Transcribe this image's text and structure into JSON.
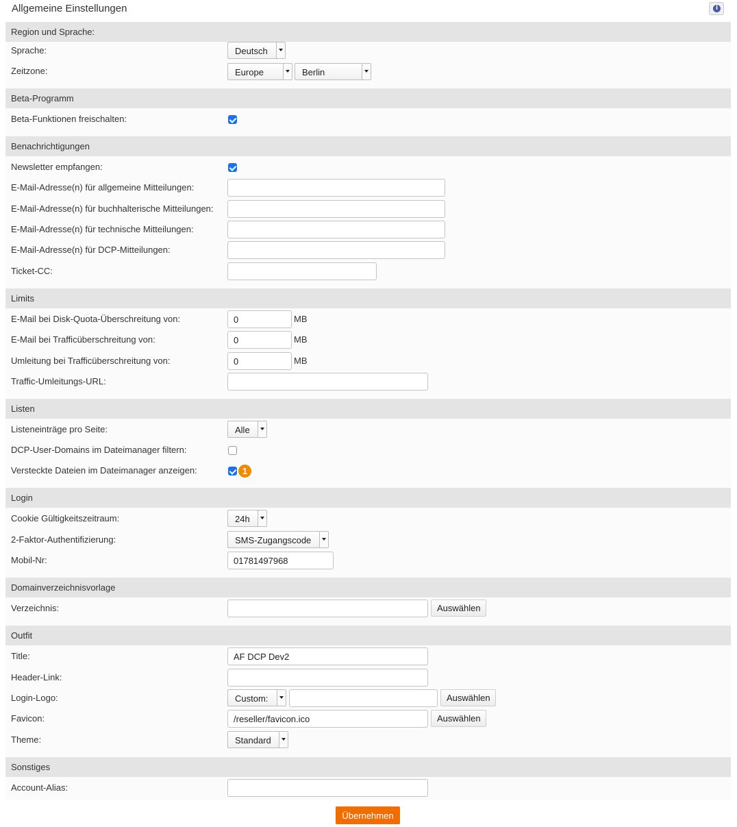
{
  "page": {
    "title": "Allgemeine Einstellungen",
    "info_icon": "info-icon",
    "submit_label": "Übernehmen"
  },
  "colors": {
    "section_bg": "#e4e4e4",
    "panel_bg": "#fbfbfb",
    "checkbox_accent": "#1a73e8",
    "submit_bg": "#f26d00",
    "badge_bg": "#f08a00"
  },
  "region": {
    "header": "Region und Sprache:",
    "language_label": "Sprache:",
    "language_value": "Deutsch",
    "timezone_label": "Zeitzone:",
    "timezone_region": "Europe",
    "timezone_city": "Berlin"
  },
  "beta": {
    "header": "Beta-Programm",
    "unlock_label": "Beta-Funktionen freischalten:",
    "unlock_checked": true
  },
  "notifications": {
    "header": "Benachrichtigungen",
    "newsletter_label": "Newsletter empfangen:",
    "newsletter_checked": true,
    "general_label": "E-Mail-Adresse(n) für allgemeine Mitteilungen:",
    "general_value": "",
    "accounting_label": "E-Mail-Adresse(n) für buchhalterische Mitteilungen:",
    "accounting_value": "",
    "technical_label": "E-Mail-Adresse(n) für technische Mitteilungen:",
    "technical_value": "",
    "dcp_label": "E-Mail-Adresse(n) für DCP-Mitteilungen:",
    "dcp_value": "",
    "ticket_cc_label": "Ticket-CC:",
    "ticket_cc_value": ""
  },
  "limits": {
    "header": "Limits",
    "disk_quota_label": "E-Mail bei Disk-Quota-Überschreitung von:",
    "disk_quota_value": "0",
    "traffic_mail_label": "E-Mail bei Trafficüberschreitung von:",
    "traffic_mail_value": "0",
    "redirect_label": "Umleitung bei Trafficüberschreitung von:",
    "redirect_value": "0",
    "unit": "MB",
    "redirect_url_label": "Traffic-Umleitungs-URL:",
    "redirect_url_value": ""
  },
  "lists": {
    "header": "Listen",
    "per_page_label": "Listeneinträge pro Seite:",
    "per_page_value": "Alle",
    "filter_label": "DCP-User-Domains im Dateimanager filtern:",
    "filter_checked": false,
    "hidden_files_label": "Versteckte Dateien im Dateimanager anzeigen:",
    "hidden_files_checked": true,
    "badge": "1"
  },
  "login": {
    "header": "Login",
    "cookie_label": "Cookie Gültigkeitszeitraum:",
    "cookie_value": "24h",
    "twofa_label": "2-Faktor-Authentifizierung:",
    "twofa_value": "SMS-Zugangscode",
    "mobile_label": "Mobil-Nr:",
    "mobile_value": "01781497968"
  },
  "domain_template": {
    "header": "Domainverzeichnisvorlage",
    "dir_label": "Verzeichnis:",
    "dir_value": "",
    "choose_label": "Auswählen"
  },
  "outfit": {
    "header": "Outfit",
    "title_label": "Title:",
    "title_value": "AF DCP Dev2",
    "header_link_label": "Header-Link:",
    "header_link_value": "",
    "login_logo_label": "Login-Logo:",
    "login_logo_mode": "Custom:",
    "login_logo_value": "",
    "favicon_label": "Favicon:",
    "favicon_value": "/reseller/favicon.ico",
    "theme_label": "Theme:",
    "theme_value": "Standard",
    "choose_label": "Auswählen"
  },
  "misc": {
    "header": "Sonstiges",
    "alias_label": "Account-Alias:",
    "alias_value": ""
  }
}
